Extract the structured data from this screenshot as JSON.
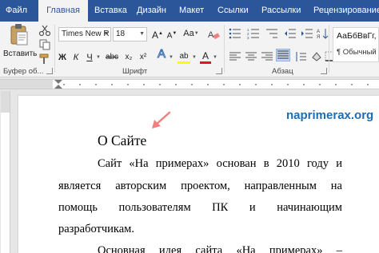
{
  "tabs": [
    {
      "label": "Файл",
      "active": false
    },
    {
      "label": "Главная",
      "active": true
    },
    {
      "label": "Вставка",
      "active": false
    },
    {
      "label": "Дизайн",
      "active": false
    },
    {
      "label": "Макет",
      "active": false
    },
    {
      "label": "Ссылки",
      "active": false
    },
    {
      "label": "Рассылки",
      "active": false
    },
    {
      "label": "Рецензирование",
      "active": false
    }
  ],
  "clipboard": {
    "paste_label": "Вставить",
    "group_label": "Буфер об..."
  },
  "font": {
    "family": "Times New R",
    "size": "18",
    "group_label": "Шрифт",
    "bold": "Ж",
    "italic": "К",
    "underline": "Ч",
    "strike": "abc",
    "subscript": "x₂",
    "superscript": "x²",
    "text_effects": "A",
    "font_color": "A",
    "highlight": "ab",
    "grow": "A",
    "shrink": "A",
    "case": "Aa"
  },
  "paragraph": {
    "group_label": "Абзац"
  },
  "styles": {
    "sample": "АаБбВвГг,",
    "name": "¶ Обычный"
  },
  "document": {
    "watermark": "naprimerax.org",
    "title": "О Сайте",
    "lines": [
      [
        "Сайт",
        "«На",
        "примерах»",
        "основан",
        "в",
        "2010",
        "году",
        "и"
      ],
      [
        "является",
        "авторским",
        "проектом,",
        "направленным",
        "на"
      ],
      [
        "помощь",
        "пользователям",
        "ПК",
        "и",
        "начинающим"
      ],
      [
        "разработчикам."
      ],
      [
        "Основная",
        "идея",
        "сайта",
        "«На",
        "примерах»",
        "–"
      ]
    ]
  },
  "colors": {
    "ribbon_tab_bar": "#2b579a",
    "watermark": "#1f6cb0",
    "pointer_arrow": "#f08080",
    "font_color_underline": "#e81123",
    "highlight_underline": "#ffff00"
  }
}
